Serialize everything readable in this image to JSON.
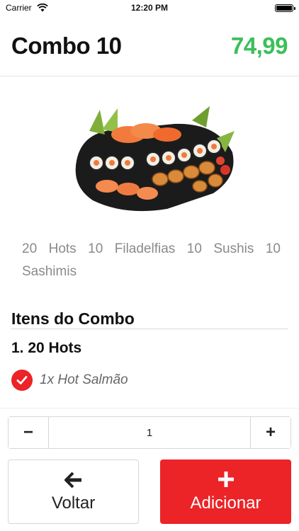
{
  "status_bar": {
    "carrier": "Carrier",
    "time": "12:20 PM"
  },
  "header": {
    "title": "Combo 10",
    "price": "74,99"
  },
  "product": {
    "image": "sushi-platter-image",
    "description": "20 Hots 10 Filadelfias 10 Sushis 10 Sashimis"
  },
  "combo": {
    "section_title": "Itens do Combo",
    "groups": [
      {
        "title": "1. 20 Hots",
        "items": [
          {
            "label": "1x Hot Salmão",
            "checked": true
          }
        ]
      }
    ]
  },
  "quantity": {
    "minus": "−",
    "value": "1",
    "plus": "+"
  },
  "actions": {
    "back_label": "Voltar",
    "add_label": "Adicionar"
  },
  "colors": {
    "accent_red": "#ec2327",
    "price_green": "#3bbf5a"
  },
  "icons": {
    "wifi": "wifi-icon",
    "battery": "battery-icon",
    "check": "check-circle-icon",
    "back": "arrow-left-icon",
    "add": "plus-icon"
  }
}
